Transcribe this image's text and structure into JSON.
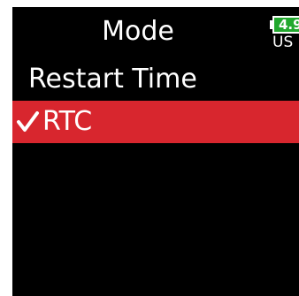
{
  "screen": {
    "title": "Mode",
    "battery": {
      "level_text": "4.9",
      "power_source": "US",
      "color": "#22a82e"
    }
  },
  "menu": {
    "items": [
      {
        "label": "Restart Time",
        "selected": false
      },
      {
        "label": "RTC",
        "selected": true,
        "icon": "checkmark-icon"
      }
    ],
    "highlight_color": "#d8262e"
  }
}
